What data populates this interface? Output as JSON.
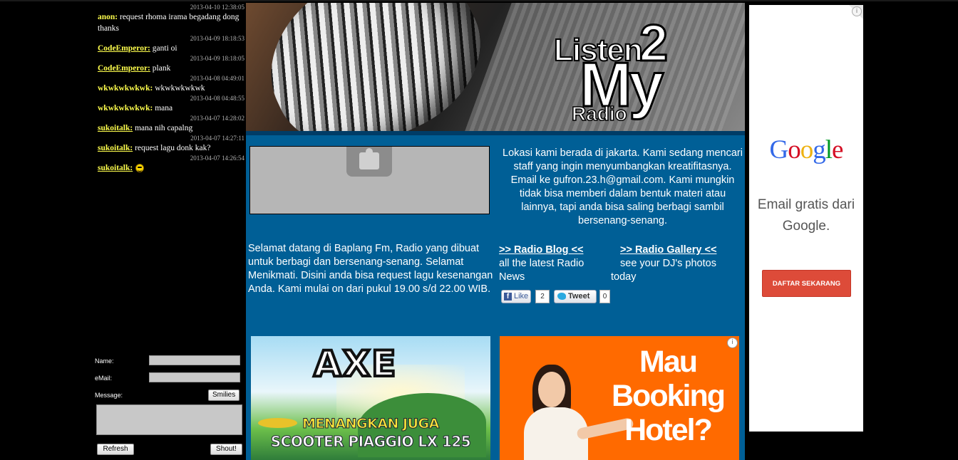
{
  "shoutbox": {
    "messages": [
      {
        "time": "2013-04-10 12:38:05",
        "nick": "anon:",
        "nick_style": "plain",
        "text": "request rhoma irama begadang dong thanks"
      },
      {
        "time": "2013-04-09 18:18:53",
        "nick": "CodeEmperor:",
        "nick_style": "link",
        "text": "ganti oi"
      },
      {
        "time": "2013-04-09 18:18:05",
        "nick": "CodeEmperor:",
        "nick_style": "link",
        "text": "plank"
      },
      {
        "time": "2013-04-08 04:49:01",
        "nick": "wkwkwkwkwk:",
        "nick_style": "plain",
        "text": "wkwkwkwkwk"
      },
      {
        "time": "2013-04-08 04:48:55",
        "nick": "wkwkwkwkwk:",
        "nick_style": "plain",
        "text": "mana"
      },
      {
        "time": "2013-04-07 14:28:02",
        "nick": "sukoitalk:",
        "nick_style": "link",
        "text": "mana nih capalng"
      },
      {
        "time": "2013-04-07 14:27:11",
        "nick": "sukoitalk:",
        "nick_style": "link",
        "text": "request lagu donk kak?"
      },
      {
        "time": "2013-04-07 14:26:54",
        "nick": "sukoitalk:",
        "nick_style": "link",
        "text": "",
        "icon": "smiley-icon"
      }
    ],
    "form": {
      "name_label": "Name:",
      "name_value": "",
      "email_label": "eMail:",
      "email_value": "",
      "message_label": "Message:",
      "smilies_label": "Smilies",
      "message_value": "",
      "refresh_label": "Refresh",
      "shout_label": "Shout!"
    }
  },
  "banner": {
    "logo_listen": "Listen",
    "logo_two": "2",
    "logo_my": "My",
    "logo_radio": "Radio"
  },
  "main": {
    "plugin_placeholder_icon": "puzzle-plugin-icon",
    "info_text": "Lokasi kami berada di jakarta. Kami sedang mencari staff yang ingin menyumbangkan kreatifitasnya. Email ke gufron.23.h@gmail.com. Kami mungkin tidak bisa memberi dalam bentuk materi atau lainnya, tapi anda bisa saling berbagi sambil bersenang-senang.",
    "welcome_text": "Selamat datang di Baplang Fm, Radio yang dibuat untuk berbagi dan bersenang-senang. Selamat Menikmati. Disini anda bisa request lagu kesenangan Anda. Kami mulai on dari pukul 19.00 s/d 22.00 WIB.",
    "blog": {
      "title": ">> Radio Blog <<",
      "desc": "all the latest Radio News"
    },
    "gallery": {
      "title": ">> Radio Gallery <<",
      "desc1": "see your DJ's photos",
      "desc2": "today"
    },
    "social": {
      "like_label": "Like",
      "like_count": "2",
      "tweet_label": "Tweet",
      "tweet_count": "0"
    }
  },
  "ads": {
    "axe": {
      "brand": "AXE",
      "line1": "MENANGKAN JUGA",
      "line2": "SCOOTER PIAGGIO LX 125"
    },
    "hotel": {
      "headline": "Mau Booking Hotel?",
      "info_icon": "info-icon"
    },
    "google": {
      "logo": "Google",
      "logo_colors": [
        "#3369e8",
        "#d50f25",
        "#eeb211",
        "#3369e8",
        "#009925",
        "#d50f25"
      ],
      "text": "Email gratis dari Google.",
      "button": "DAFTAR SEKARANG",
      "button_color": "#dd4b39",
      "info_icon": "info-icon"
    }
  },
  "colors": {
    "main_bg": "#005f96",
    "nick_color": "#ffff4d",
    "page_bg": "#000000"
  }
}
